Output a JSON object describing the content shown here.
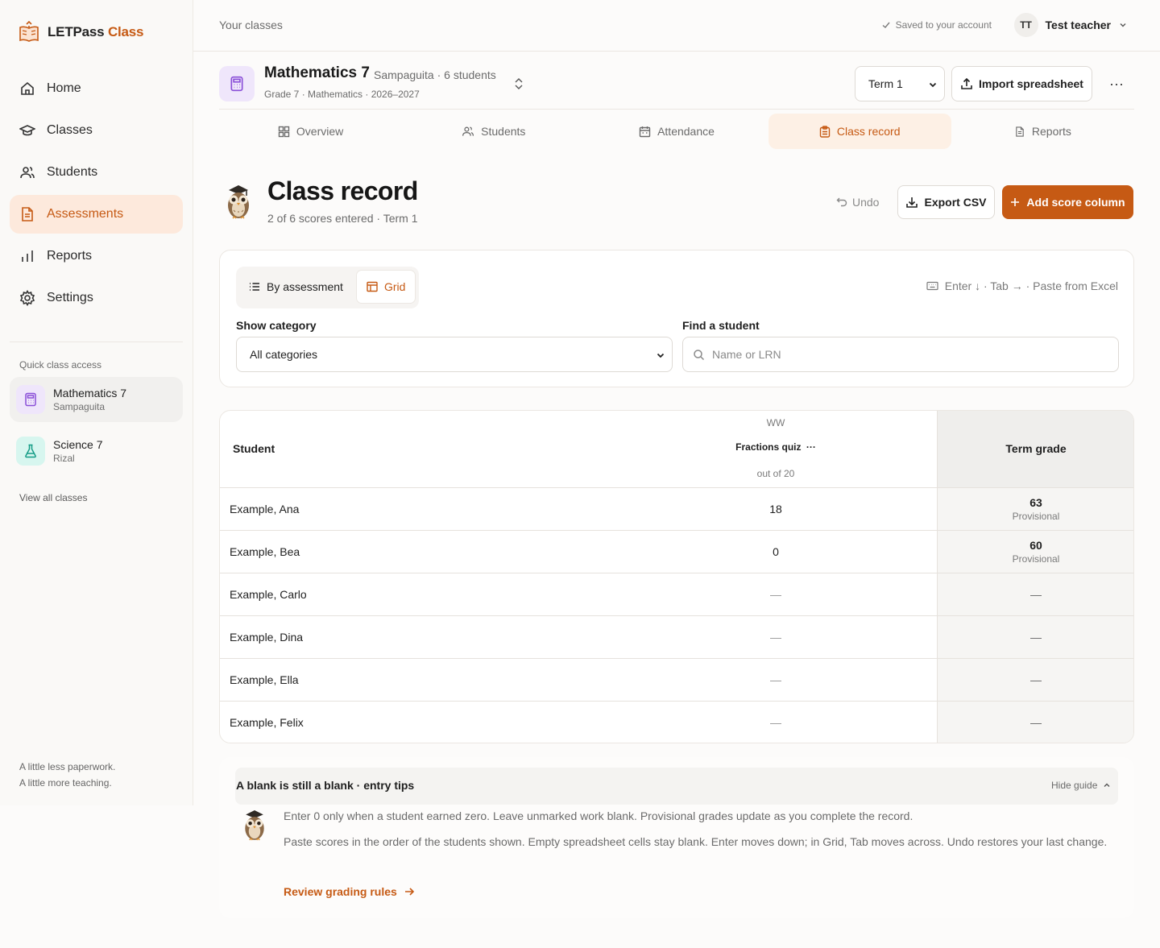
{
  "brand": {
    "name": "LETPass",
    "accent": "Class"
  },
  "nav": [
    {
      "label": "Home",
      "icon": "home-icon"
    },
    {
      "label": "Classes",
      "icon": "graduation-cap-icon"
    },
    {
      "label": "Students",
      "icon": "users-icon"
    },
    {
      "label": "Assessments",
      "icon": "document-icon",
      "active": true
    },
    {
      "label": "Reports",
      "icon": "bar-chart-icon"
    },
    {
      "label": "Settings",
      "icon": "gear-icon"
    }
  ],
  "quick_access": {
    "label": "Quick class access",
    "classes": [
      {
        "name": "Mathematics 7",
        "section": "Sampaguita",
        "icon": "calculator-icon"
      },
      {
        "name": "Science 7",
        "section": "Rizal",
        "icon": "flask-icon"
      }
    ],
    "view_all": "View all classes"
  },
  "tagline": {
    "line1": "A little less paperwork.",
    "line2": "A little more teaching."
  },
  "topbar": {
    "crumb": "Your classes",
    "saved": "Saved to your account",
    "user_initials": "TT",
    "user_name": "Test teacher"
  },
  "class": {
    "title": "Mathematics 7",
    "meta": "Sampaguita · 6 students",
    "sub": "Grade 7 · Mathematics · 2026–2027",
    "term": "Term 1",
    "import_label": "Import spreadsheet",
    "more": "···"
  },
  "tabs": [
    {
      "label": "Overview",
      "icon": "grid-icon"
    },
    {
      "label": "Students",
      "icon": "users-icon"
    },
    {
      "label": "Attendance",
      "icon": "calendar-icon"
    },
    {
      "label": "Class record",
      "icon": "clipboard-icon",
      "active": true
    },
    {
      "label": "Reports",
      "icon": "document-icon"
    }
  ],
  "page": {
    "title": "Class record",
    "sub": "2 of 6 scores entered · Term 1",
    "undo": "Undo",
    "export": "Export CSV",
    "add": "Add score column"
  },
  "filters": {
    "view_by_assessment": "By assessment",
    "view_grid": "Grid",
    "shortcuts": "Enter ↓ · Tab → · Paste from Excel",
    "category_label": "Show category",
    "category_value": "All categories",
    "search_label": "Find a student",
    "search_placeholder": "Name or LRN"
  },
  "table": {
    "student_header": "Student",
    "category": "WW",
    "assessment": "Fractions quiz",
    "assessment_menu": "···",
    "out_of": "out of 20",
    "grade_header": "Term grade",
    "rows": [
      {
        "name": "Example, Ana",
        "score": "18",
        "grade": "63",
        "status": "Provisional"
      },
      {
        "name": "Example, Bea",
        "score": "0",
        "grade": "60",
        "status": "Provisional"
      },
      {
        "name": "Example, Carlo",
        "score": "—",
        "grade": "—",
        "status": ""
      },
      {
        "name": "Example, Dina",
        "score": "—",
        "grade": "—",
        "status": ""
      },
      {
        "name": "Example, Ella",
        "score": "—",
        "grade": "—",
        "status": ""
      },
      {
        "name": "Example, Felix",
        "score": "—",
        "grade": "—",
        "status": ""
      }
    ]
  },
  "guide": {
    "title": "A blank is still a blank · entry tips",
    "hide": "Hide guide",
    "p1": "Enter 0 only when a student earned zero. Leave unmarked work blank. Provisional grades update as you complete the record.",
    "p2": "Paste scores in the order of the students shown. Empty spreadsheet cells stay blank. Enter moves down; in Grid, Tab moves across. Undo restores your last change.",
    "link": "Review grading rules"
  },
  "colors": {
    "accent": "#c65a14",
    "accent_soft": "#fde9dc",
    "border": "#ebe7e2"
  }
}
